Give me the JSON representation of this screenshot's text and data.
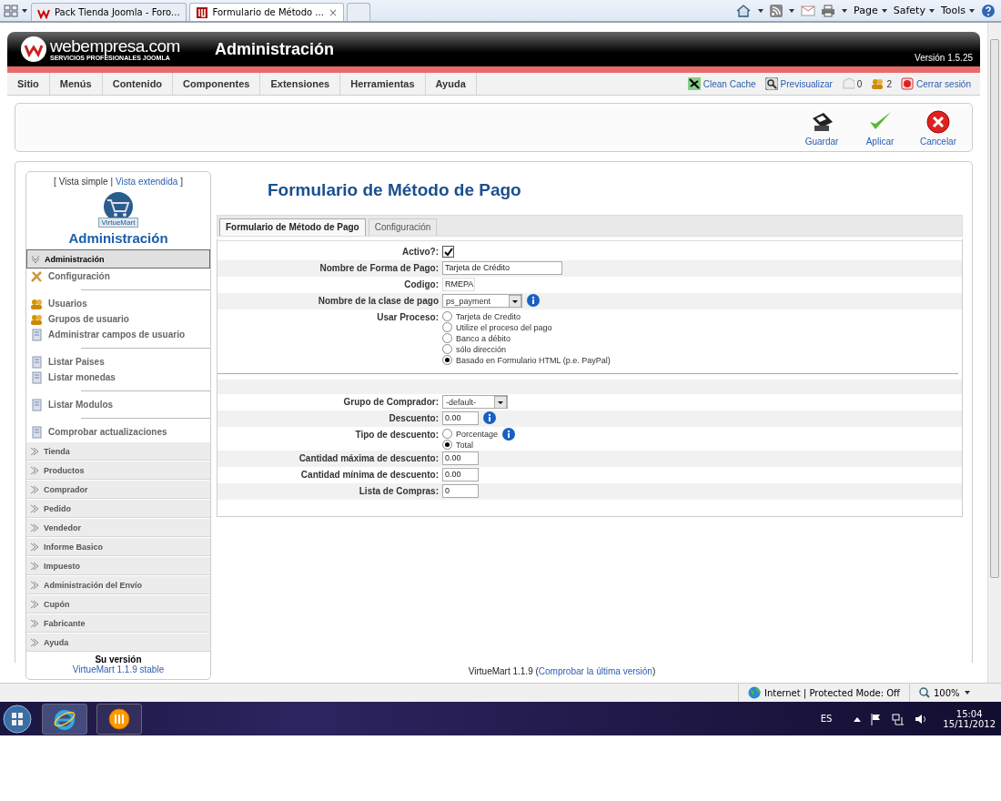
{
  "browser": {
    "tabs": [
      {
        "title": "Pack Tienda Joomla - Foro...",
        "selected": false
      },
      {
        "title": "Formulario de Método ...",
        "selected": true,
        "close": "×"
      }
    ],
    "commands": [
      "Page",
      "Safety",
      "Tools"
    ]
  },
  "header": {
    "brand": "webempresa.com",
    "tagline": "SERVICIOS PROFESIONALES JOOMLA",
    "title": "Administración",
    "version": "Versión 1.5.25"
  },
  "menu": [
    "Sitio",
    "Menús",
    "Contenido",
    "Componentes",
    "Extensiones",
    "Herramientas",
    "Ayuda"
  ],
  "status_links": [
    {
      "kind": "cache",
      "label": "Clean Cache"
    },
    {
      "kind": "preview",
      "label": "Previsualizar"
    },
    {
      "kind": "messages",
      "label": "0"
    },
    {
      "kind": "users",
      "label": "2"
    },
    {
      "kind": "logout",
      "label": "Cerrar sesión"
    }
  ],
  "toolbar": [
    {
      "kind": "save",
      "label": "Guardar"
    },
    {
      "kind": "apply",
      "label": "Aplicar"
    },
    {
      "kind": "cancel",
      "label": "Cancelar"
    }
  ],
  "sidebar": {
    "view_switch": {
      "open": "[",
      "simple": "Vista simple",
      "separator": "|",
      "extended": "Vista extendida",
      "close": "]"
    },
    "logo_text": "VirtueMart",
    "title": "Administración",
    "sections": [
      {
        "label": "Administración",
        "expanded": true,
        "groups": [
          [
            {
              "kind": "config",
              "label": "Configuración"
            }
          ],
          [
            {
              "kind": "users",
              "label": "Usuarios"
            },
            {
              "kind": "users",
              "label": "Grupos de usuario"
            },
            {
              "kind": "page",
              "label": "Administrar campos de usuario"
            }
          ],
          [
            {
              "kind": "page",
              "label": "Listar Paises"
            },
            {
              "kind": "page",
              "label": "Listar monedas"
            }
          ],
          [
            {
              "kind": "page",
              "label": "Listar Modulos"
            }
          ],
          [
            {
              "kind": "page",
              "label": "Comprobar actualizaciones"
            }
          ]
        ]
      },
      {
        "label": "Tienda",
        "expanded": false
      },
      {
        "label": "Productos",
        "expanded": false
      },
      {
        "label": "Comprador",
        "expanded": false
      },
      {
        "label": "Pedido",
        "expanded": false
      },
      {
        "label": "Vendedor",
        "expanded": false
      },
      {
        "label": "Informe Basico",
        "expanded": false
      },
      {
        "label": "Impuesto",
        "expanded": false
      },
      {
        "label": "Administración del Envío",
        "expanded": false
      },
      {
        "label": "Cupón",
        "expanded": false
      },
      {
        "label": "Fabricante",
        "expanded": false
      },
      {
        "label": "Ayuda",
        "expanded": false
      }
    ],
    "version_label": "Su versión",
    "version": "VirtueMart 1.1.9 stable"
  },
  "content": {
    "title": "Formulario de Método de Pago",
    "tabs": [
      {
        "label": "Formulario de Método de Pago",
        "selected": true
      },
      {
        "label": "Configuración",
        "selected": false
      }
    ],
    "fields": [
      {
        "kind": "checkbox",
        "label": "Activo?:",
        "checked": true
      },
      {
        "kind": "text",
        "label": "Nombre de Forma de Pago:",
        "value": "Tarjeta de Crédito"
      },
      {
        "kind": "code",
        "label": "Codigo:",
        "value": "RMEPA"
      },
      {
        "kind": "select",
        "label": "Nombre de la clase de pago",
        "value": "ps_payment",
        "info": true
      },
      {
        "kind": "radios",
        "label": "Usar Proceso:",
        "options": [
          {
            "label": "Tarjeta de Credito",
            "selected": false
          },
          {
            "label": "Utilize el proceso del pago",
            "selected": false
          },
          {
            "label": "Banco a débito",
            "selected": false
          },
          {
            "label": "sólo dirección",
            "selected": false
          },
          {
            "label": "Basado en Formulario HTML (p.e. PayPal)",
            "selected": true
          }
        ]
      }
    ],
    "fields2": [
      {
        "kind": "select",
        "label": "Grupo de Comprador:",
        "value": "-default-"
      },
      {
        "kind": "number",
        "label": "Descuento:",
        "value": "0.00",
        "info": true
      },
      {
        "kind": "radios",
        "label": "Tipo de descuento:",
        "info": true,
        "options": [
          {
            "label": "Porcentage",
            "selected": false
          },
          {
            "label": "Total",
            "selected": true
          }
        ]
      },
      {
        "kind": "number",
        "label": "Cantidad máxima de descuento:",
        "value": "0.00"
      },
      {
        "kind": "number",
        "label": "Cantidad mínima de descuento:",
        "value": "0.00"
      },
      {
        "kind": "number",
        "label": "Lista de Compras:",
        "value": "0"
      }
    ]
  },
  "footer": {
    "prefix": "VirtueMart 1.1.9 (",
    "link": "Comprobar la última versión",
    "suffix": ")"
  },
  "ie_status": {
    "zone": "Internet | Protected Mode: Off",
    "zoom": "100%"
  },
  "taskbar": {
    "language": "ES",
    "time": "15:04",
    "date": "15/11/2012"
  }
}
